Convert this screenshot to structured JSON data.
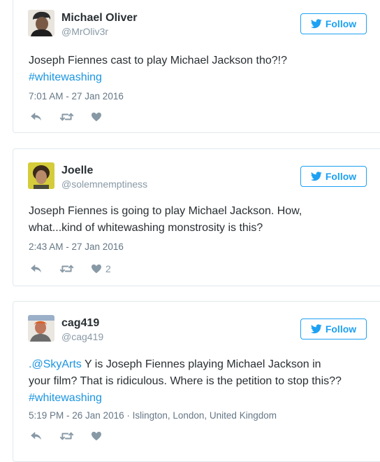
{
  "tweets": [
    {
      "name": "Michael Oliver",
      "handle": "@MrOliv3r",
      "follow_label": "Follow",
      "text_line1": "Joseph Fiennes cast to play Michael Jackson tho?!?",
      "hashtag": "#whitewashing",
      "timestamp": "7:01 AM - 27 Jan 2016",
      "likes": ""
    },
    {
      "name": "Joelle",
      "handle": "@solemnemptiness",
      "follow_label": "Follow",
      "text_line1": "Joseph Fiennes is going to play Michael Jackson. How,",
      "text_line2": "what...kind of whitewashing monstrosity is this?",
      "timestamp": "2:43 AM - 27 Jan 2016",
      "likes": "2"
    },
    {
      "name": "cag419",
      "handle": "@cag419",
      "follow_label": "Follow",
      "mention": ".@SkyArts",
      "text_line1_rest": " Y is Joseph Fiennes playing Michael Jackson in",
      "text_line2": "your film? That is ridiculous. Where is the petition to stop this??",
      "hashtag": "#whitewashing",
      "timestamp": "5:19 PM - 26 Jan 2016 · Islington, London, United Kingdom",
      "likes": ""
    }
  ],
  "icons": {
    "reply": "reply-icon",
    "retweet": "retweet-icon",
    "like": "heart-icon",
    "bird": "twitter-bird-icon"
  },
  "colors": {
    "accent": "#1da1f2",
    "link": "#1b95e0",
    "muted": "#8899a6"
  }
}
